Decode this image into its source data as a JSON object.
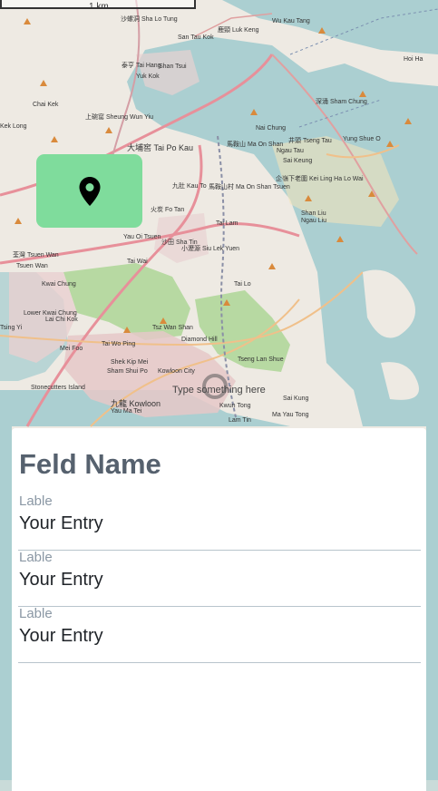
{
  "map": {
    "scale_label": "1 km",
    "places": [
      {
        "name": "沙螺洞 Sha Lo Tung"
      },
      {
        "name": "San Tau Kok"
      },
      {
        "name": "鹿頸 Luk Keng"
      },
      {
        "name": "Wu Kau Tang"
      },
      {
        "name": "Hoi Ha"
      },
      {
        "name": "泰亨 Tai Hang"
      },
      {
        "name": "Shan Tsui"
      },
      {
        "name": "Yuk Kok"
      },
      {
        "name": "Chai Kek"
      },
      {
        "name": "上碗窰 Sheung Wun Yiu"
      },
      {
        "name": "深涌 Sham Chung"
      },
      {
        "name": "Kek Long"
      },
      {
        "name": "大埔窖 Tai Po Kau"
      },
      {
        "name": "Nai Chung"
      },
      {
        "name": "馬鞍山 Ma On Shan"
      },
      {
        "name": "井頭 Tseng Tau"
      },
      {
        "name": "Yung Shue O"
      },
      {
        "name": "Ngau Tau"
      },
      {
        "name": "Sai Keung"
      },
      {
        "name": "企嶺下老圍 Kei Ling Ha Lo Wai"
      },
      {
        "name": "九肚 Kau To"
      },
      {
        "name": "馬鞍山村 Ma On Shan Tsuen"
      },
      {
        "name": "火炭 Fo Tan"
      },
      {
        "name": "Tai Lam"
      },
      {
        "name": "Shan Liu"
      },
      {
        "name": "Ngau Liu"
      },
      {
        "name": "Yau Oi Tsuen"
      },
      {
        "name": "沙田 Sha Tin"
      },
      {
        "name": "Tsuen Wan"
      },
      {
        "name": "小瀝源 Siu Lek Yuen"
      },
      {
        "name": "Tai Wai"
      },
      {
        "name": "Tai Lo"
      },
      {
        "name": "Kwai Chung"
      },
      {
        "name": "荃灣 Tsuen Wan"
      },
      {
        "name": "Lower Kwai Chung"
      },
      {
        "name": "Lai Chi Kok"
      },
      {
        "name": "Tsing Yi"
      },
      {
        "name": "Tsz Wan Shan"
      },
      {
        "name": "Diamond Hill"
      },
      {
        "name": "Tai Wo Ping"
      },
      {
        "name": "Mei Foo"
      },
      {
        "name": "Sham Shui Po"
      },
      {
        "name": "Shek Kip Mei"
      },
      {
        "name": "Kowloon City"
      },
      {
        "name": "Tseng Lan Shue"
      },
      {
        "name": "Stonecutters Island"
      },
      {
        "name": "Kwun Tong"
      },
      {
        "name": "Sai Kung"
      },
      {
        "name": "九龍 Kowloon"
      },
      {
        "name": "Lam Tin"
      },
      {
        "name": "Ma Yau Tong"
      },
      {
        "name": "Yau Ma Tei"
      }
    ],
    "center_hint": "Type something here",
    "location_button_icon": "map-pin-icon",
    "location_button_color": "#7fdc9c"
  },
  "form": {
    "title": "Feld Name",
    "fields": [
      {
        "label": "Lable",
        "value": "Your Entry"
      },
      {
        "label": "Lable",
        "value": "Your Entry"
      },
      {
        "label": "Lable",
        "value": "Your Entry"
      }
    ]
  }
}
